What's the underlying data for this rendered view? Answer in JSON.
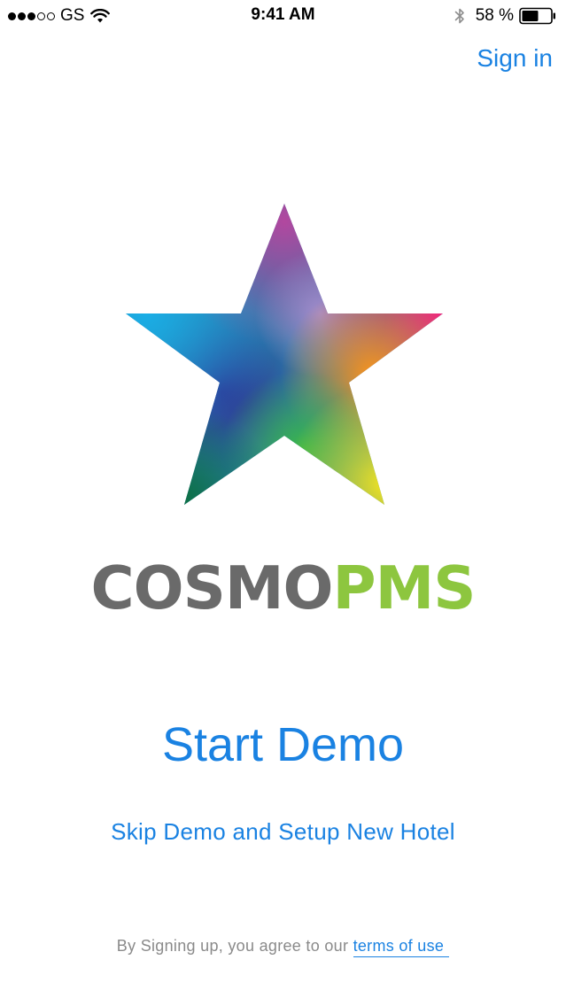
{
  "status_bar": {
    "signal_bars_filled": 3,
    "signal_bars_total": 5,
    "carrier": "GS",
    "time": "9:41 AM",
    "battery_percent_text": "58 %",
    "battery_level": 0.58,
    "icons": [
      "wifi-icon",
      "bluetooth-icon",
      "battery-icon"
    ]
  },
  "header": {
    "sign_in_label": "Sign in"
  },
  "logo": {
    "word_gray": "COSMO",
    "word_green": "PMS",
    "colors": {
      "gray": "#6a6a6a",
      "green": "#8dc63f",
      "star_gradient": [
        "#1fb0e8",
        "#b24aa8",
        "#ee2a7b",
        "#f7941d",
        "#f5e61c",
        "#3ab54a",
        "#0c7a4a",
        "#2e3192"
      ]
    }
  },
  "actions": {
    "start_demo_label": "Start Demo",
    "skip_demo_label": "Skip Demo and Setup New Hotel"
  },
  "footer": {
    "terms_prefix": "By Signing up, you agree to our",
    "terms_link_label": "terms of use"
  },
  "theme": {
    "accent": "#1a82e2",
    "background": "#ffffff",
    "muted_text": "#8a8a8a"
  }
}
